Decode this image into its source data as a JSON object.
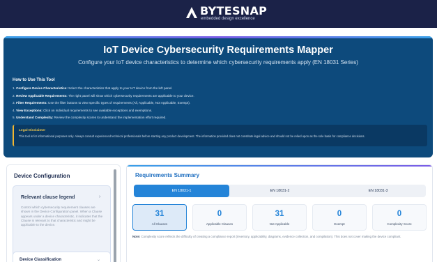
{
  "brand": {
    "name": "BYTESNAP",
    "tagline": "embedded design excellence"
  },
  "hero": {
    "title": "IoT Device Cybersecurity Requirements Mapper",
    "subtitle": "Configure your IoT device characteristics to determine which cybersecurity requirements apply (EN 18031 Series)",
    "howto_title": "How to Use This Tool",
    "steps": [
      {
        "label": "Configure Device Characteristics:",
        "text": " Select the characteristics that apply to your IoT device from the left panel."
      },
      {
        "label": "Review Applicable Requirements:",
        "text": " The right panel will show which cybersecurity requirements are applicable to your device."
      },
      {
        "label": "Filter Requirements:",
        "text": " Use the filter buttons to view specific types of requirements (All, Applicable, Not Applicable, Exempt)."
      },
      {
        "label": "View Exceptions:",
        "text": " Click on individual requirements to see available exceptions and exemptions."
      },
      {
        "label": "Understand Complexity:",
        "text": " Review the complexity scores to understand the implementation effort required."
      }
    ],
    "disclaimer_title": "Legal Disclaimer",
    "disclaimer_text": "This tool is for informational purposes only. Always consult experienced technical professionals before starting any product development. The information provided does not constitute legal advice and should not be relied upon as the sole basis for compliance decisions."
  },
  "sidebar": {
    "title": "Device Configuration",
    "legend_title": "Relevant clause legend",
    "legend_text": "Control which cybersecurity requirement clauses are shown in the Device Configuration panel. When a Clause appears under a device characteristic, it indicates that the Clause is relevant to that characteristic and might be applicable to the device.",
    "classification_title": "Device Classification"
  },
  "summary": {
    "title": "Requirements Summary",
    "tabs": [
      "EN 18031-1",
      "EN 18031-2",
      "EN 18031-3"
    ],
    "active_tab": 0,
    "stats": [
      {
        "value": "31",
        "label": "All Clauses"
      },
      {
        "value": "0",
        "label": "Applicable Clauses"
      },
      {
        "value": "31",
        "label": "Not Applicable"
      },
      {
        "value": "0",
        "label": "Exempt"
      },
      {
        "value": "0",
        "label": "Complexity Score"
      }
    ],
    "note_label": "Note:",
    "note_text": " Complexity score reflects the difficulty of creating a compliance report (inventory, applicability, diagrams, evidence collection, and compilation). This does not cover making the device compliant."
  },
  "colors": {
    "topbar": "#1b2248",
    "hero": "#0d4a7c",
    "accent": "#2484d8",
    "disclaimer_accent": "#f2b630"
  }
}
